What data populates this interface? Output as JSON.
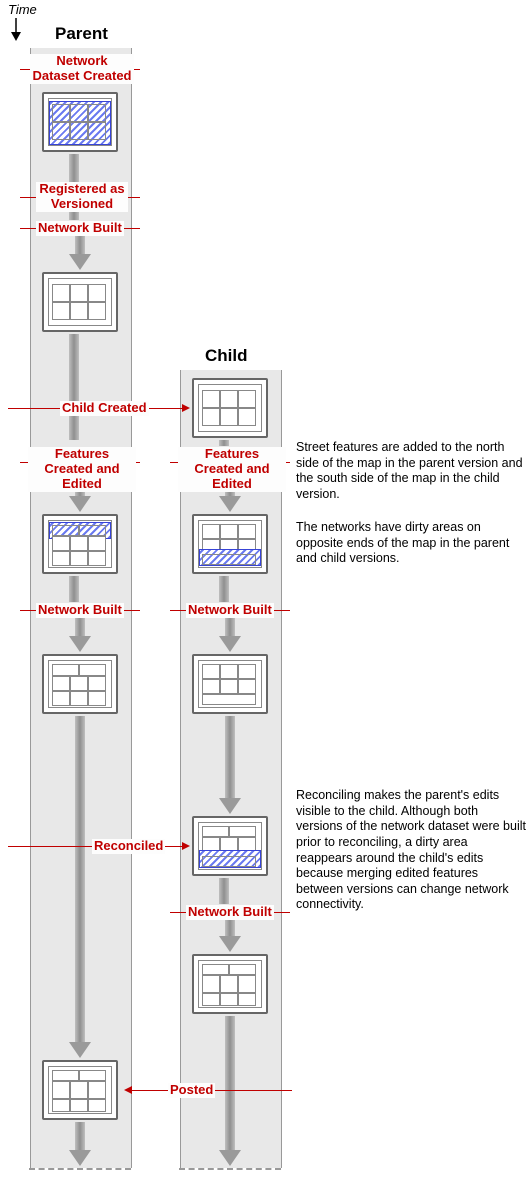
{
  "time_label": "Time",
  "columns": {
    "parent": "Parent",
    "child": "Child"
  },
  "labels": {
    "nd_created": "Network Dataset Created",
    "reg_versioned": "Registered as Versioned",
    "net_built": "Network Built",
    "child_created": "Child Created",
    "feat_edited": "Features Created and Edited",
    "reconciled": "Reconciled",
    "posted": "Posted"
  },
  "notes": {
    "n1": "Street features are added to the north side of the map in the parent version and the south side of the map in the child version.",
    "n2": "The networks have dirty areas on opposite ends of the map in the parent and child versions.",
    "n3": "Reconciling makes the parent's edits visible to the child. Although both versions of the network dataset were built prior to reconciling, a dirty area reappears around the child's edits because merging edited features between versions can change network connectivity."
  }
}
